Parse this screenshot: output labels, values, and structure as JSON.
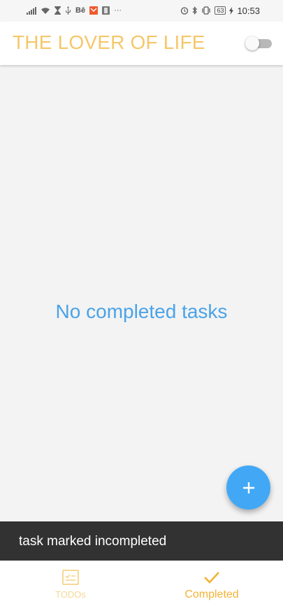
{
  "colors": {
    "title": "#f5c76a",
    "accent": "#f2b233",
    "accent_inactive": "#f6d896",
    "empty_text": "#4aa3e8",
    "fab": "#42a8f6",
    "snackbar": "#323232",
    "background": "#f3f3f3"
  },
  "status_bar": {
    "battery": "63",
    "time": "10:53",
    "left_icons": [
      "signal-icon",
      "wifi-icon",
      "hourglass-icon",
      "usb-icon",
      "behance-icon",
      "mail-app-icon",
      "app-icon",
      "more-icon"
    ],
    "right_icons": [
      "alarm-icon",
      "bluetooth-icon",
      "vibrate-icon",
      "battery-icon",
      "charging-icon"
    ],
    "behance_text": "Bē",
    "more_text": "···"
  },
  "app_bar": {
    "title": "THE LOVER OF LIFE",
    "toggle_on": false
  },
  "main": {
    "empty_message": "No completed tasks"
  },
  "fab": {
    "icon": "plus-icon"
  },
  "snackbar": {
    "message": "task marked incompleted"
  },
  "bottom_nav": {
    "items": [
      {
        "label": "TODOs",
        "icon": "checklist-icon",
        "selected": false
      },
      {
        "label": "Completed",
        "icon": "check-icon",
        "selected": true
      }
    ]
  }
}
